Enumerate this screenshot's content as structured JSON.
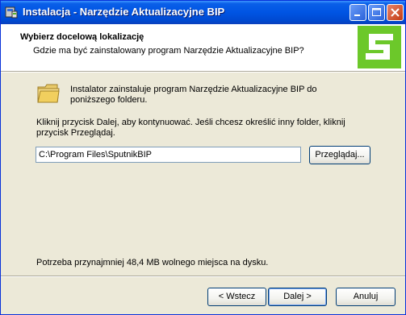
{
  "window": {
    "title": "Instalacja - Narzędzie Aktualizacyjne BIP"
  },
  "header": {
    "title": "Wybierz docelową lokalizację",
    "subtitle": "Gdzie ma być zainstalowany program Narzędzie Aktualizacyjne BIP?"
  },
  "main": {
    "info_text": "Instalator zainstaluje program Narzędzie Aktualizacyjne BIP do poniższego folderu.",
    "instruction_text": "Kliknij przycisk Dalej, aby kontynuować. Jeśli chcesz określić inny folder, kliknij przycisk Przeglądaj.",
    "path_value": "C:\\Program Files\\SputnikBIP",
    "browse_label": "Przeglądaj...",
    "space_required": "Potrzeba przynajmniej 48,4 MB wolnego miejsca na dysku."
  },
  "footer": {
    "back_label": "< Wstecz",
    "next_label": "Dalej >",
    "cancel_label": "Anuluj"
  },
  "colors": {
    "titlebar": "#0054e3",
    "logo_green": "#6cc82a",
    "dialog_bg": "#ece9d8"
  }
}
